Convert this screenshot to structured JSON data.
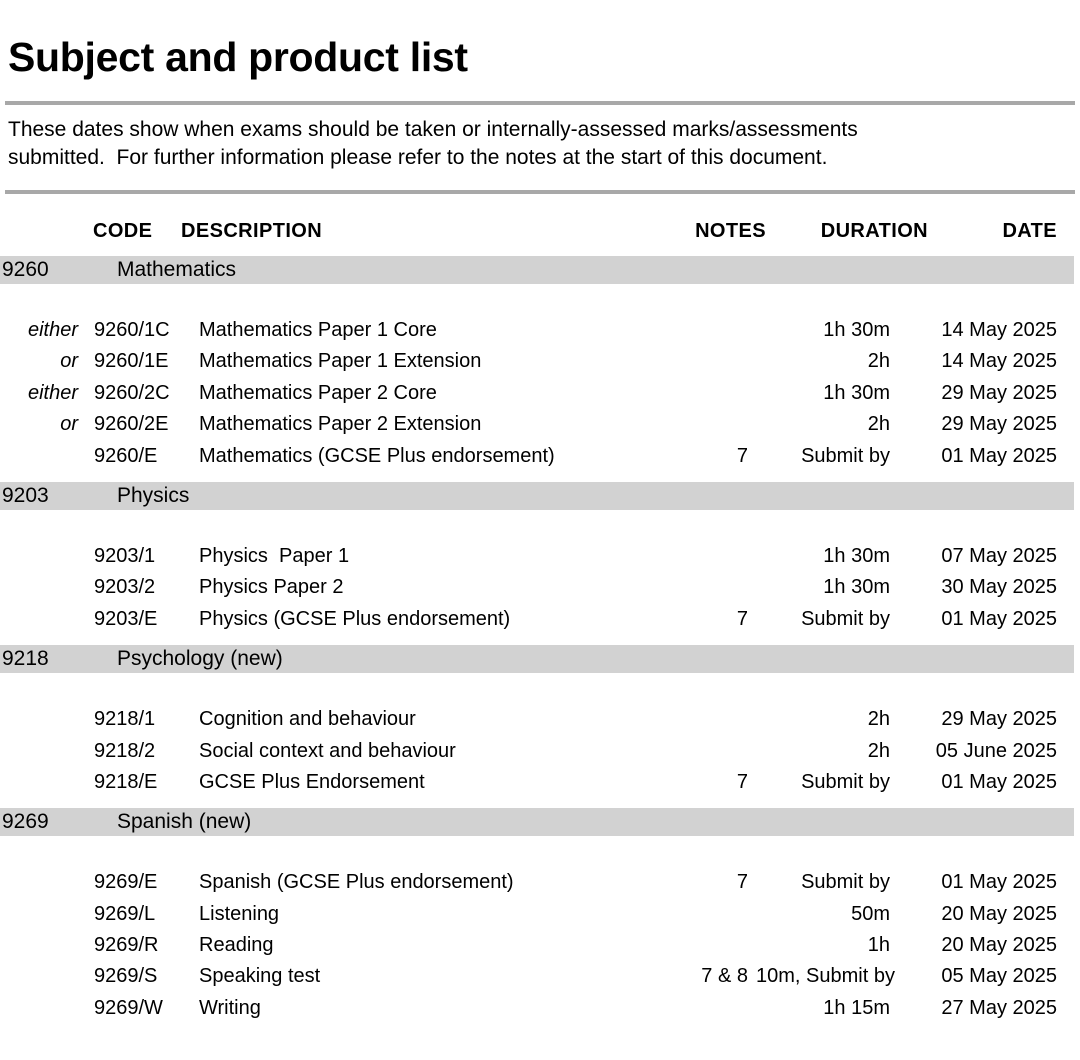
{
  "document": {
    "title": "Subject and product list",
    "intro_lines": [
      "These dates show when exams should be taken or internally-assessed marks/assessments",
      "submitted.  For further information please refer to the notes at the start of this document."
    ]
  },
  "theme": {
    "band_color": "#d2d2d2",
    "rule_color": "#a8a8a8",
    "text_color": "#000000",
    "background_color": "#ffffff"
  },
  "table": {
    "headers": {
      "either_or": "",
      "code": "CODE",
      "description": "DESCRIPTION",
      "notes": "NOTES",
      "duration": "DURATION",
      "date": "DATE"
    },
    "sections": [
      {
        "code": "9260",
        "name": "Mathematics",
        "rows": [
          {
            "either_or": "either",
            "code": "9260/1C",
            "description": "Mathematics Paper 1 Core",
            "notes": "",
            "duration": "1h 30m",
            "date": "14 May 2025"
          },
          {
            "either_or": "or",
            "code": "9260/1E",
            "description": "Mathematics Paper 1 Extension",
            "notes": "",
            "duration": "2h",
            "date": "14 May 2025"
          },
          {
            "either_or": "either",
            "code": "9260/2C",
            "description": "Mathematics Paper 2 Core",
            "notes": "",
            "duration": "1h 30m",
            "date": "29 May 2025"
          },
          {
            "either_or": "or",
            "code": "9260/2E",
            "description": "Mathematics Paper 2 Extension",
            "notes": "",
            "duration": "2h",
            "date": "29 May 2025"
          },
          {
            "either_or": "",
            "code": "9260/E",
            "description": "Mathematics (GCSE Plus endorsement)",
            "notes": "7",
            "duration": "Submit by",
            "date": "01 May 2025"
          }
        ]
      },
      {
        "code": "9203",
        "name": "Physics",
        "rows": [
          {
            "either_or": "",
            "code": "9203/1",
            "description": "Physics  Paper 1",
            "notes": "",
            "duration": "1h 30m",
            "date": "07 May 2025"
          },
          {
            "either_or": "",
            "code": "9203/2",
            "description": "Physics Paper 2",
            "notes": "",
            "duration": "1h 30m",
            "date": "30 May 2025"
          },
          {
            "either_or": "",
            "code": "9203/E",
            "description": "Physics (GCSE Plus endorsement)",
            "notes": "7",
            "duration": "Submit by",
            "date": "01 May 2025"
          }
        ]
      },
      {
        "code": "9218",
        "name": "Psychology (new)",
        "rows": [
          {
            "either_or": "",
            "code": "9218/1",
            "description": "Cognition and behaviour",
            "notes": "",
            "duration": "2h",
            "date": "29 May 2025"
          },
          {
            "either_or": "",
            "code": "9218/2",
            "description": "Social context and behaviour",
            "notes": "",
            "duration": "2h",
            "date": "05 June 2025"
          },
          {
            "either_or": "",
            "code": "9218/E",
            "description": "GCSE Plus Endorsement",
            "notes": "7",
            "duration": "Submit by",
            "date": "01 May 2025"
          }
        ]
      },
      {
        "code": "9269",
        "name": "Spanish (new)",
        "rows": [
          {
            "either_or": "",
            "code": "9269/E",
            "description": "Spanish (GCSE Plus endorsement)",
            "notes": "7",
            "duration": "Submit by",
            "date": "01 May 2025"
          },
          {
            "either_or": "",
            "code": "9269/L",
            "description": "Listening",
            "notes": "",
            "duration": "50m",
            "date": "20 May 2025"
          },
          {
            "either_or": "",
            "code": "9269/R",
            "description": "Reading",
            "notes": "",
            "duration": "1h",
            "date": "20 May 2025"
          },
          {
            "either_or": "",
            "code": "9269/S",
            "description": "Speaking test",
            "notes": "7 & 8",
            "duration": "10m, Submit by",
            "date": "05 May 2025"
          },
          {
            "either_or": "",
            "code": "9269/W",
            "description": "Writing",
            "notes": "",
            "duration": "1h 15m",
            "date": "27 May 2025"
          }
        ]
      }
    ]
  }
}
